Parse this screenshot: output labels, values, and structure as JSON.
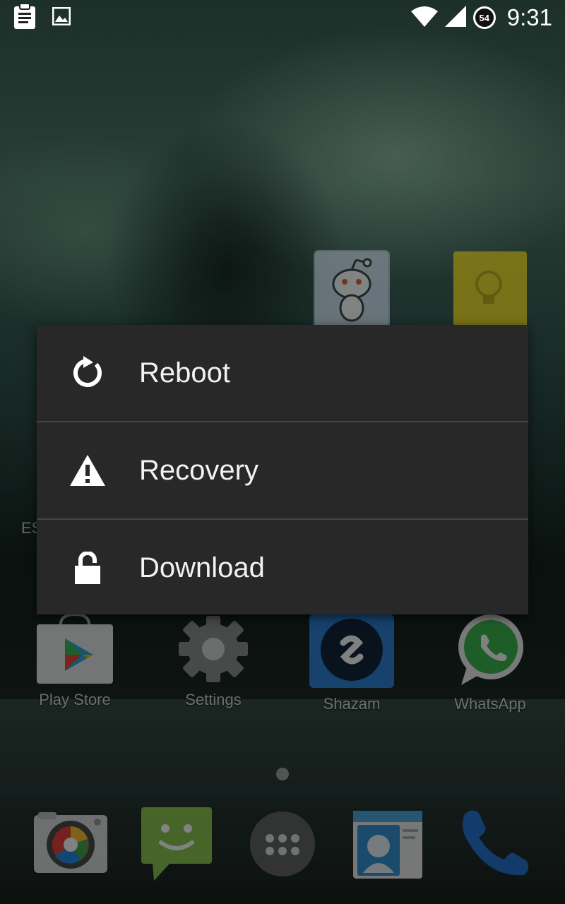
{
  "status_bar": {
    "left_icons": [
      "clipboard-icon",
      "image-icon"
    ],
    "right_icons": [
      "wifi-icon",
      "signal-icon"
    ],
    "battery_level": "54",
    "time": "9:31"
  },
  "home_screen": {
    "top_row_icons": [
      "reddit-icon",
      "keep-icon"
    ],
    "partial_label": "ES",
    "apps": [
      {
        "label": "Play Store",
        "icon": "play-store-icon"
      },
      {
        "label": "Settings",
        "icon": "settings-icon"
      },
      {
        "label": "Shazam",
        "icon": "shazam-icon"
      },
      {
        "label": "WhatsApp",
        "icon": "whatsapp-icon"
      }
    ],
    "dock": [
      "camera-icon",
      "messaging-icon",
      "app-drawer-icon",
      "contacts-icon",
      "phone-icon"
    ]
  },
  "power_menu": {
    "items": [
      {
        "label": "Reboot",
        "icon": "reboot-icon"
      },
      {
        "label": "Recovery",
        "icon": "warning-icon"
      },
      {
        "label": "Download",
        "icon": "lock-icon"
      }
    ]
  },
  "colors": {
    "dialog_bg": "#282828",
    "divider": "#454545",
    "text": "#f2f2f2"
  }
}
